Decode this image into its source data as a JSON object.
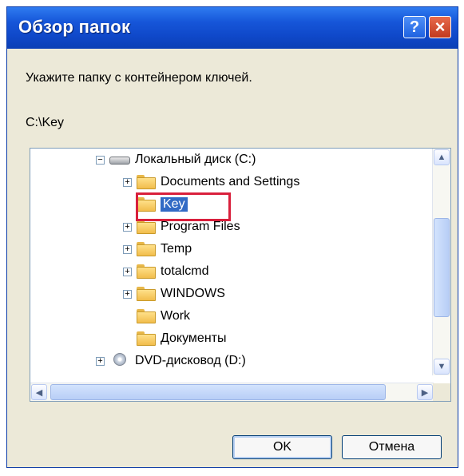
{
  "window": {
    "title": "Обзор папок",
    "help_label": "?",
    "close_label": "×"
  },
  "prompt": "Укажите папку с контейнером ключей.",
  "current_path": "C:\\Key",
  "tree": {
    "drive_c": "Локальный диск (C:)",
    "folders": [
      "Documents and Settings",
      "Key",
      "Program Files",
      "Temp",
      "totalcmd",
      "WINDOWS",
      "Work",
      "Документы"
    ],
    "drive_d": "DVD-дисковод (D:)",
    "expander_plus": "+",
    "expander_minus": "−"
  },
  "buttons": {
    "ok": "OK",
    "cancel": "Отмена"
  },
  "colors": {
    "selection_highlight": "#316ac5",
    "annotation_box": "#d9203c"
  }
}
